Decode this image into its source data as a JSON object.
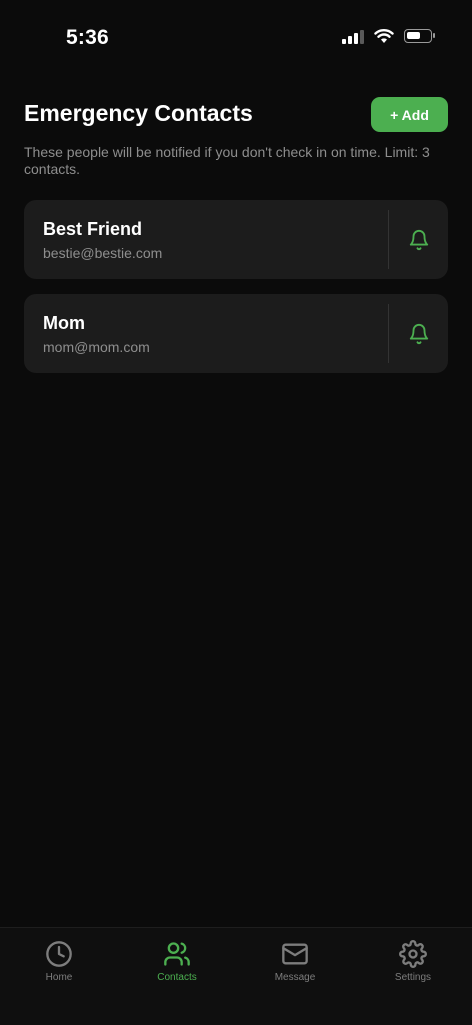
{
  "status_bar": {
    "time": "5:36"
  },
  "header": {
    "title": "Emergency Contacts",
    "add_button_label": "+ Add",
    "subtitle": "These people will be notified if you don't check in on time. Limit: 3 contacts."
  },
  "contacts": [
    {
      "name": "Best Friend",
      "email": "bestie@bestie.com"
    },
    {
      "name": "Mom",
      "email": "mom@mom.com"
    }
  ],
  "tabs": [
    {
      "label": "Home",
      "icon": "clock-icon",
      "active": false
    },
    {
      "label": "Contacts",
      "icon": "people-icon",
      "active": true
    },
    {
      "label": "Message",
      "icon": "envelope-icon",
      "active": false
    },
    {
      "label": "Settings",
      "icon": "gear-icon",
      "active": false
    }
  ],
  "colors": {
    "accent": "#4caf50",
    "background": "#0b0b0b",
    "card": "#1c1c1c",
    "muted_text": "#8e8e8e"
  }
}
